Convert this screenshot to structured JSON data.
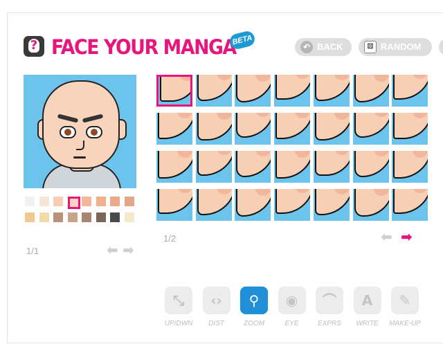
{
  "header": {
    "logo_icon": "mask-logo-icon",
    "title": "FACE YOUR MANGA",
    "beta": "BETA",
    "back_label": "BACK",
    "random_label": "RANDOM"
  },
  "colors": {
    "brand_pink": "#e8157c",
    "beta_blue": "#1d9ad6",
    "panel_blue": "#6cc3ec",
    "active_tool": "#1f8fd8"
  },
  "skin_palette": {
    "row1": [
      "#f1f1f1",
      "#f5e7d8",
      "#f6cdb5",
      "#f8d2bc",
      "#f3b79a",
      "#f1b18c",
      "#ebaa8a",
      "#e4a58a"
    ],
    "row2": [
      "#f0c992",
      "#f3dba7",
      "#b99377",
      "#c7a387",
      "#a88572",
      "#7c6659",
      "#4a4a4a",
      "#f4e9c9"
    ],
    "selected": "row1.3"
  },
  "preview_pager": "1/1",
  "options_pager": "1/2",
  "tools": [
    {
      "name": "up-down",
      "label": "UP/DWN",
      "icon": "expand-arrows-icon",
      "active": false
    },
    {
      "name": "dist",
      "label": "DIST",
      "icon": "code-brackets-icon",
      "active": false
    },
    {
      "name": "zoom",
      "label": "ZOOM",
      "icon": "magnifier-icon",
      "active": true
    },
    {
      "name": "eye",
      "label": "EYE",
      "icon": "eye-icon",
      "active": false
    },
    {
      "name": "exprs",
      "label": "EXPRS",
      "icon": "eyebrow-icon",
      "active": false
    },
    {
      "name": "write",
      "label": "WRITE",
      "icon": "letter-a-icon",
      "active": false
    },
    {
      "name": "makeup",
      "label": "MAKE-UP",
      "icon": "lipstick-icon",
      "active": false
    }
  ]
}
